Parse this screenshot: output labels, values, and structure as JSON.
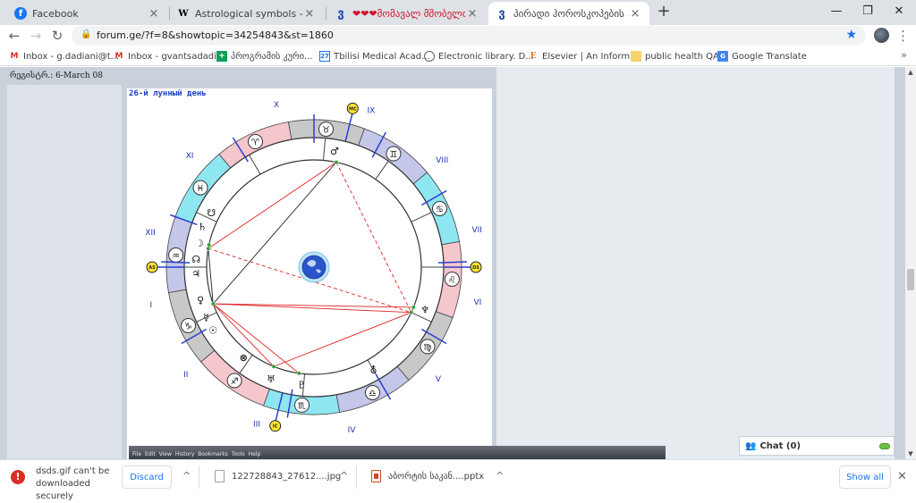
{
  "tabs": [
    {
      "title": "Facebook",
      "favicon": "f"
    },
    {
      "title": "Astrological symbols - Wikipedia",
      "favicon": "W"
    },
    {
      "title": "❤❤❤მომავალ მშობელთა",
      "favicon": "ვ"
    },
    {
      "title": "პირადი ჰოროსკოპების ანალ",
      "favicon": "ვ"
    }
  ],
  "window_controls": {
    "minimize": "—",
    "maximize": "❐",
    "close": "✕"
  },
  "address": {
    "url": "forum.ge/?f=8&showtopic=34254843&st=1860"
  },
  "bookmarks": [
    {
      "label": "Inbox - g.dadiani@t...",
      "icon": "gmail-icon"
    },
    {
      "label": "Inbox - gvantsadadi...",
      "icon": "gmail-icon"
    },
    {
      "label": "პროგრამის კური...",
      "icon": "sheets-icon"
    },
    {
      "label": "Tbilisi Medical Acad...",
      "icon": "calendar-icon"
    },
    {
      "label": "Electronic library. D...",
      "icon": "globe-icon"
    },
    {
      "label": "Elsevier | An Inform...",
      "icon": "elsevier-icon"
    },
    {
      "label": "public health QA",
      "icon": "folder-icon"
    },
    {
      "label": "Google Translate",
      "icon": "translate-icon"
    }
  ],
  "post": {
    "date": "რეგისტრ.: 6-March 08",
    "lunar_day": "26-й лунный день"
  },
  "firefox_menu": [
    "File",
    "Edit",
    "View",
    "History",
    "Bookmarks",
    "Tools",
    "Help"
  ],
  "chart_data": {
    "type": "natal-wheel",
    "houses": [
      "I",
      "II",
      "III",
      "IV",
      "V",
      "VI",
      "VII",
      "VIII",
      "IX",
      "X",
      "XI",
      "XII"
    ],
    "zodiac_glyphs": [
      "♉",
      "♈",
      "♓",
      "♒",
      "♑",
      "♐",
      "♏",
      "♎",
      "♍",
      "♌",
      "♋",
      "♊"
    ],
    "angle_labels": {
      "mc": "MC",
      "ic": "IC",
      "as": "AS",
      "ds": "DS"
    },
    "planet_glyphs": [
      "♂",
      "☊",
      "♄",
      "♆",
      "♅",
      "♇",
      "⛢",
      "♀",
      "☿",
      "☉",
      "♃",
      "☽",
      "☋",
      "⊗"
    ],
    "aspect_colors": {
      "tense": "#e02020",
      "neutral": "#202020"
    },
    "ring_colors": {
      "cardinal": "#f5c6cc",
      "fixed": "#8ee6f0",
      "mutable": "#c4c6ea",
      "earth": "#c8c8c8"
    }
  },
  "chat": {
    "label": "Chat (0)"
  },
  "downloads": {
    "warning": "dsds.gif can't be downloaded securely",
    "discard": "Discard",
    "items": [
      {
        "name": "122728843_27612....jpg",
        "type": "image"
      },
      {
        "name": "აბორტის საკან....pptx",
        "type": "pptx"
      }
    ],
    "show_all": "Show all"
  }
}
